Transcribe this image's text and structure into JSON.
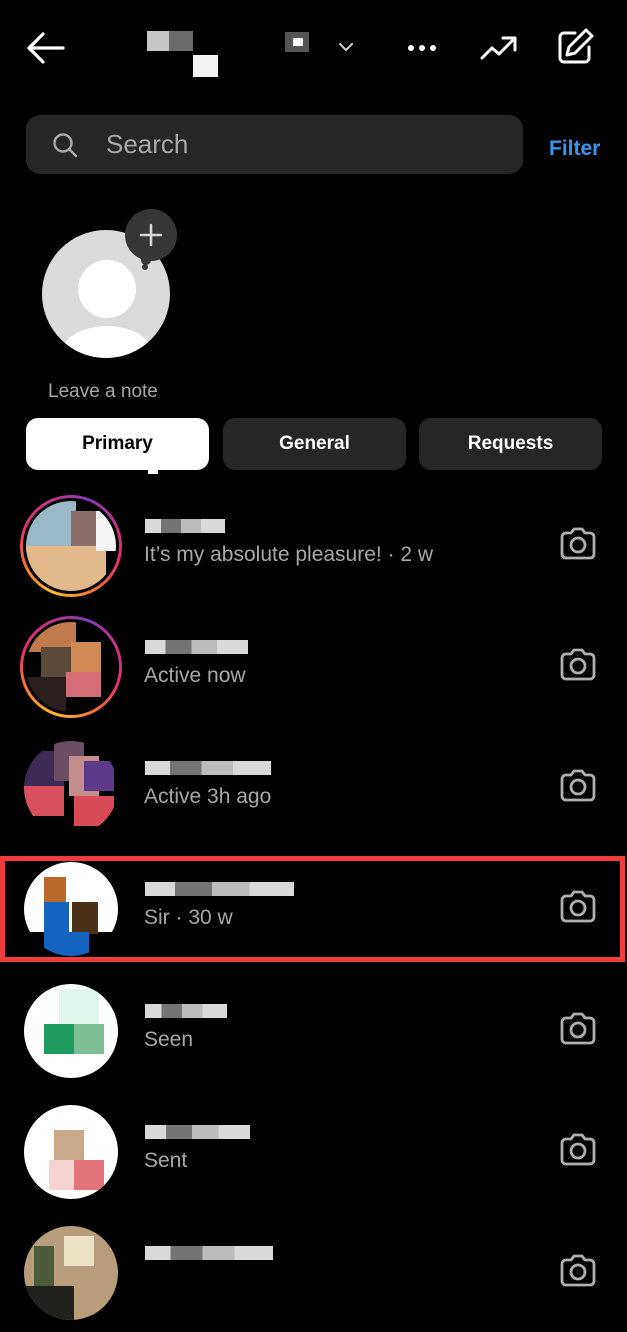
{
  "header": {
    "title": "[redacted username]",
    "icons": {
      "back": "arrow-left-icon",
      "account_switch": "chevron-down-icon",
      "more": "more-horizontal-icon",
      "insights": "trending-up-icon",
      "compose": "compose-icon"
    }
  },
  "search": {
    "placeholder": "Search",
    "value": "",
    "icon": "search-icon"
  },
  "filter_label": "Filter",
  "note": {
    "label": "Leave a note",
    "add_icon": "plus-icon"
  },
  "tabs": [
    {
      "label": "Primary",
      "active": true
    },
    {
      "label": "General",
      "active": false
    },
    {
      "label": "Requests",
      "active": false
    }
  ],
  "threads": [
    {
      "name": "[redacted]",
      "preview": "It’s my absolute pleasure! · 2 w",
      "story_ring": true,
      "highlighted": false
    },
    {
      "name": "[redacted]",
      "preview": "Active now",
      "story_ring": true,
      "highlighted": false
    },
    {
      "name": "[redacted]",
      "preview": "Active 3h ago",
      "story_ring": false,
      "highlighted": false
    },
    {
      "name": "[redacted]",
      "preview": "Sir · 30 w",
      "story_ring": false,
      "highlighted": true
    },
    {
      "name": "[redacted]",
      "preview": "Seen",
      "story_ring": false,
      "highlighted": false
    },
    {
      "name": "[redacted]",
      "preview": "Sent",
      "story_ring": false,
      "highlighted": false
    },
    {
      "name": "[redacted]",
      "preview": "",
      "story_ring": false,
      "highlighted": false
    }
  ],
  "colors": {
    "background": "#000000",
    "surface": "#262626",
    "accent": "#3797f0",
    "secondary_text": "#a8a8a8",
    "highlight_box": "#f03c3c"
  }
}
